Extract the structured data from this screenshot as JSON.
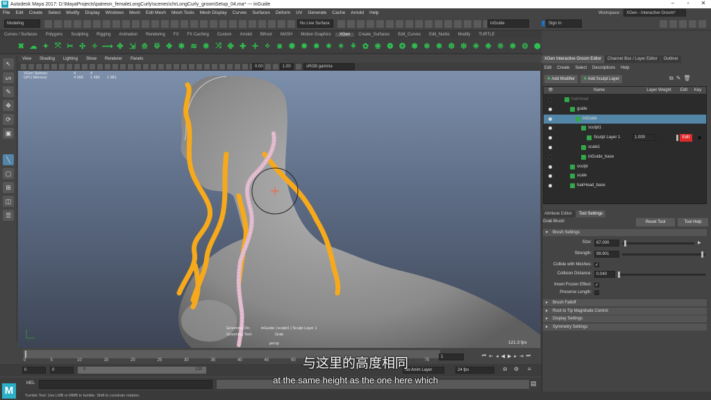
{
  "title": "Autodesk Maya 2017: D:\\MayaProjects\\patreon_femaleLongCurly\\scenes\\chrLongCurly_groomSetup_04.ma*   ---   inGuide",
  "menus": [
    "File",
    "Edit",
    "Create",
    "Select",
    "Modify",
    "Display",
    "Windows",
    "Mesh",
    "Edit Mesh",
    "Mesh Tools",
    "Mesh Display",
    "Curves",
    "Surfaces",
    "Deform",
    "UV",
    "Generate",
    "Cache",
    "Arnold",
    "Help"
  ],
  "workspace": {
    "label": "Workspace :",
    "value": "XGen - Interactive Groom*"
  },
  "status": {
    "mode": "Modeling",
    "live_surface": "No Live Surface",
    "object_field": "inGuide",
    "sign_in": "Sign In"
  },
  "shelf_tabs": [
    "Curves / Surfaces",
    "Polygons",
    "Sculpting",
    "Rigging",
    "Animation",
    "Rendering",
    "FX",
    "FX Caching",
    "Custom",
    "Arnold",
    "Bifrost",
    "MASH",
    "Motion Graphics",
    "XGen",
    "Create_Surfaces",
    "Edit_Curves",
    "Edit_Nurbs",
    "Modify",
    "TURTLE"
  ],
  "shelf_active": "XGen",
  "viewport": {
    "menus": [
      "View",
      "Shading",
      "Lighting",
      "Show",
      "Renderer",
      "Panels"
    ],
    "gamma": "sRGB gamma",
    "field_a": "0.00",
    "field_b": "1.00",
    "hud_rows": [
      {
        "label": "XGen Splines:",
        "c1": "4",
        "c2": "4",
        "c3": ""
      },
      {
        "label": "GPU Memory:",
        "c1": "4 096",
        "c2": "1 486",
        "c3": "1 981"
      }
    ],
    "grooming_on_label": "Grooming On:",
    "grooming_on_value": "inGuide | sculpt1 | Sculpt Layer 1",
    "grooming_tool_label": "Grooming Tool:",
    "grooming_tool_value": "Grab",
    "camera": "persp",
    "fps": "121.3 fps"
  },
  "panel": {
    "tabs": [
      "XGen Interactive Groom Editor",
      "Channel Box / Layer Editor",
      "Outliner"
    ],
    "menu": [
      "Edit",
      "Create",
      "Select",
      "Descriptions",
      "Help"
    ],
    "add_modifier": "Add Modifier",
    "add_sculpt_layer": "Add Sculpt Layer",
    "columns": [
      "Name",
      "Layer Weight",
      "Edit",
      "Key"
    ],
    "rows": [
      {
        "name": "hairHead",
        "indent": 1,
        "eye": false,
        "sel": false
      },
      {
        "name": "guide",
        "indent": 2,
        "eye": true,
        "sel": false
      },
      {
        "name": "inGuide",
        "indent": 3,
        "eye": true,
        "sel": true
      },
      {
        "name": "sculpt1",
        "indent": 4,
        "eye": true,
        "sel": false
      },
      {
        "name": "Sculpt Layer 1",
        "indent": 5,
        "eye": true,
        "sel": false,
        "weight": "1.000",
        "edit": "Edit"
      },
      {
        "name": "scale1",
        "indent": 4,
        "eye": true,
        "sel": false
      },
      {
        "name": "inGuide_base",
        "indent": 4,
        "eye": false,
        "sel": false
      },
      {
        "name": "sculpt",
        "indent": 2,
        "eye": true,
        "sel": false
      },
      {
        "name": "scale",
        "indent": 2,
        "eye": true,
        "sel": false
      },
      {
        "name": "hairHead_base",
        "indent": 2,
        "eye": true,
        "sel": false
      }
    ]
  },
  "attr": {
    "tabs": [
      "Attribute Editor",
      "Tool Settings"
    ],
    "tool": "Grab Brush",
    "reset_tool": "Reset Tool",
    "tool_help": "Tool Help",
    "brush_settings": "Brush Settings",
    "size_label": "Size:",
    "size": "67.000",
    "strength_label": "Strength:",
    "strength": "99.901",
    "collide_label": "Collide with Meshes:",
    "collision_label": "Collision Distance:",
    "collision": "0.040",
    "invert_label": "Invert Frozen Effect:",
    "preserve_label": "Preserve Length:",
    "sections": [
      "Brush Falloff",
      "Root to Tip Magnitude Control",
      "Display Settings",
      "Symmetry Settings"
    ]
  },
  "timeline": {
    "ticks": [
      "0",
      "5",
      "10",
      "15",
      "20",
      "25",
      "30",
      "35",
      "40",
      "45",
      "50",
      "55",
      "60",
      "65",
      "70",
      "75"
    ],
    "current": "1",
    "range_start": "0",
    "range_start2": "0",
    "range_end": "120",
    "layer_label": "No Anim Layer",
    "fps": "24 fps"
  },
  "mel_label": "MEL",
  "help_line": "Tumble Tool: Use LMB or MMB to tumble. Shift to constrain rotation.",
  "subtitle_cn": "与这里的高度相同",
  "subtitle_en": "at the same height as the one here which"
}
